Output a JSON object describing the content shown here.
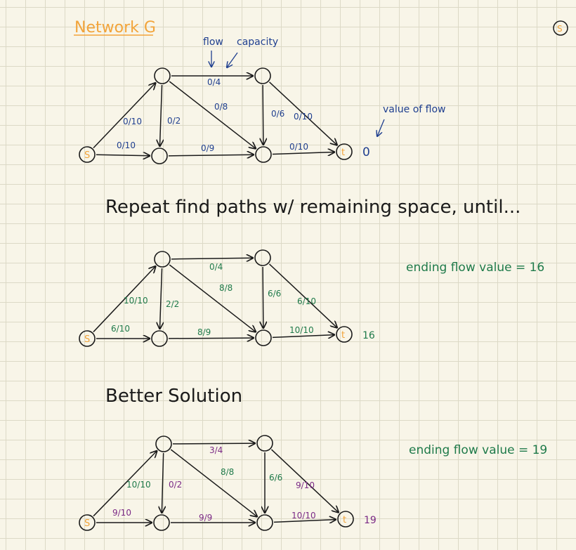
{
  "title": "Network G",
  "annotations": {
    "flow": "flow",
    "capacity": "capacity",
    "value_of_flow": "value of flow"
  },
  "repeat_text": "Repeat find paths w/ remaining space, until...",
  "better_text": "Better Solution",
  "colors": {
    "ink": "#1a1a1a",
    "orange": "#f2a43a",
    "blue": "#1f3f8f",
    "green": "#1f7a4a",
    "purple": "#7b2a86"
  },
  "node_labels": {
    "s": "S",
    "t": "t"
  },
  "graphs": [
    {
      "labels": {
        "s_a": "0/10",
        "s_b": "0/10",
        "a_c": "0/4",
        "a_b": "0/2",
        "a_d": "0/8",
        "b_d": "0/9",
        "c_d": "0/6",
        "c_t": "0/10",
        "d_t": "0/10"
      },
      "value": "0",
      "side": ""
    },
    {
      "labels": {
        "s_a": "10/10",
        "s_b": "6/10",
        "a_c": "0/4",
        "a_b": "2/2",
        "a_d": "8/8",
        "b_d": "8/9",
        "c_d": "6/6",
        "c_t": "6/10",
        "d_t": "10/10"
      },
      "value": "16",
      "side": "ending flow value = 16"
    },
    {
      "labels": {
        "s_a": "10/10",
        "s_b": "9/10",
        "a_c": "3/4",
        "a_b": "0/2",
        "a_d": "8/8",
        "b_d": "9/9",
        "c_d": "6/6",
        "c_t": "9/10",
        "d_t": "10/10"
      },
      "value": "19",
      "side": "ending flow value = 19"
    }
  ]
}
